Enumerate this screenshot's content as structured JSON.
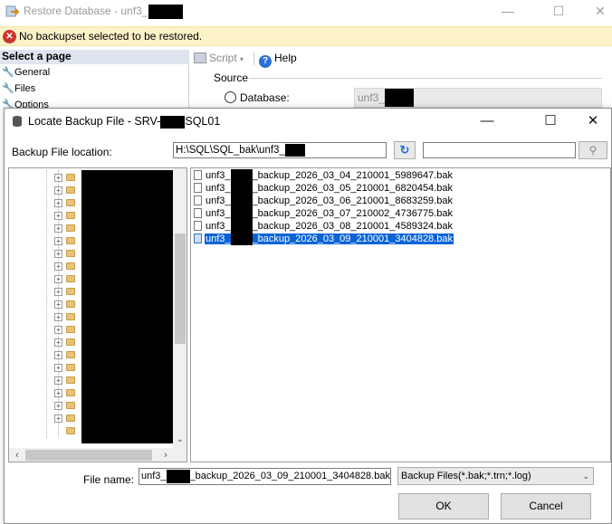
{
  "restore_window": {
    "title": "Restore Database - unf3_",
    "error_message": "No backupset selected to be restored.",
    "select_page_header": "Select a page",
    "pages": [
      "General",
      "Files",
      "Options"
    ],
    "toolbar": {
      "script_label": "Script",
      "help_label": "Help"
    },
    "source_label": "Source",
    "database_label": "Database:",
    "database_value": "unf3_"
  },
  "locate_dialog": {
    "title_prefix": "Locate Backup File - SRV-",
    "title_suffix": "SQL01",
    "backup_location_label": "Backup File location:",
    "backup_location_value": "H:\\SQL\\SQL_bak\\unf3_",
    "search_value": "",
    "files": [
      {
        "prefix": "unf3_",
        "suffix": "_backup_2026_03_04_210001_5989647.bak",
        "selected": false
      },
      {
        "prefix": "unf3_",
        "suffix": "_backup_2026_03_05_210001_6820454.bak",
        "selected": false
      },
      {
        "prefix": "unf3_",
        "suffix": "_backup_2026_03_06_210001_8683259.bak",
        "selected": false
      },
      {
        "prefix": "unf3_",
        "suffix": "_backup_2026_03_07_210002_4736775.bak",
        "selected": false
      },
      {
        "prefix": "unf3_",
        "suffix": "_backup_2026_03_08_210001_4589324.bak",
        "selected": false
      },
      {
        "prefix": "unf3_",
        "suffix": "_backup_2026_03_09_210001_3404828.bak",
        "selected": true
      }
    ],
    "file_name_label": "File name:",
    "file_name_prefix": "unf3_",
    "file_name_suffix": "_backup_2026_03_09_210001_3404828.bak",
    "file_type_value": "Backup Files(*.bak;*.trn;*.log)",
    "ok_label": "OK",
    "cancel_label": "Cancel"
  },
  "colors": {
    "selection": "#0a64d8",
    "error_bar": "#fbf2c8",
    "error_icon": "#c9372c",
    "help_icon": "#2a6fd6"
  },
  "icons": [
    "restore-app-icon",
    "error-icon",
    "wrench-icon",
    "script-icon",
    "help-icon",
    "database-icon",
    "refresh-icon",
    "search-icon",
    "folder-icon",
    "file-icon",
    "chevron-down-icon"
  ]
}
